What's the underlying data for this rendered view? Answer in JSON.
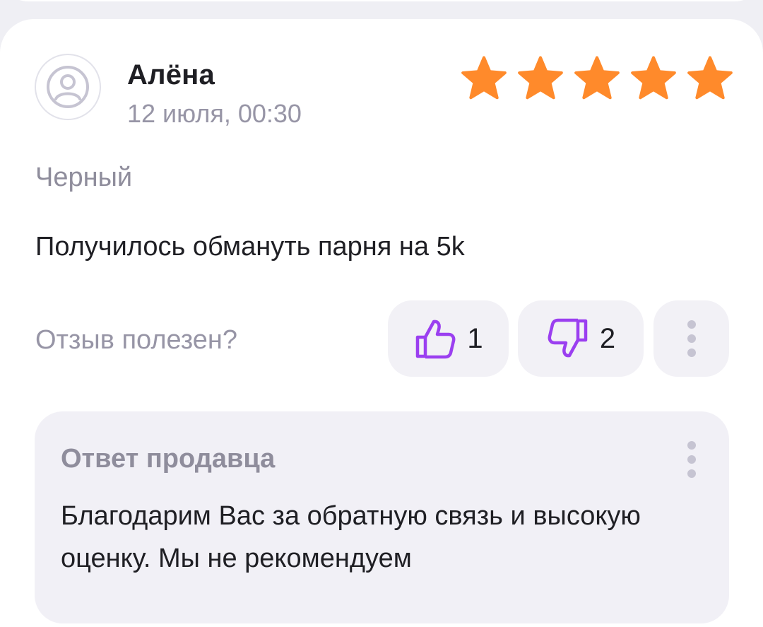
{
  "review": {
    "author": "Алёна",
    "date": "12 июля, 00:30",
    "rating": 5,
    "variant": "Черный",
    "text": "Получилось обмануть парня на 5k"
  },
  "feedback": {
    "label": "Отзыв полезен?",
    "likes": "1",
    "dislikes": "2"
  },
  "seller_reply": {
    "title": "Ответ продавца",
    "text": "Благодарим Вас за обратную связь и высокую оценку. Мы не рекомендуем"
  },
  "colors": {
    "star": "#ff8a2b",
    "accent": "#9b3ff0",
    "muted": "#9795a6"
  },
  "icons": [
    "avatar-icon",
    "star-icon",
    "thumbs-up-icon",
    "thumbs-down-icon",
    "more-icon"
  ]
}
